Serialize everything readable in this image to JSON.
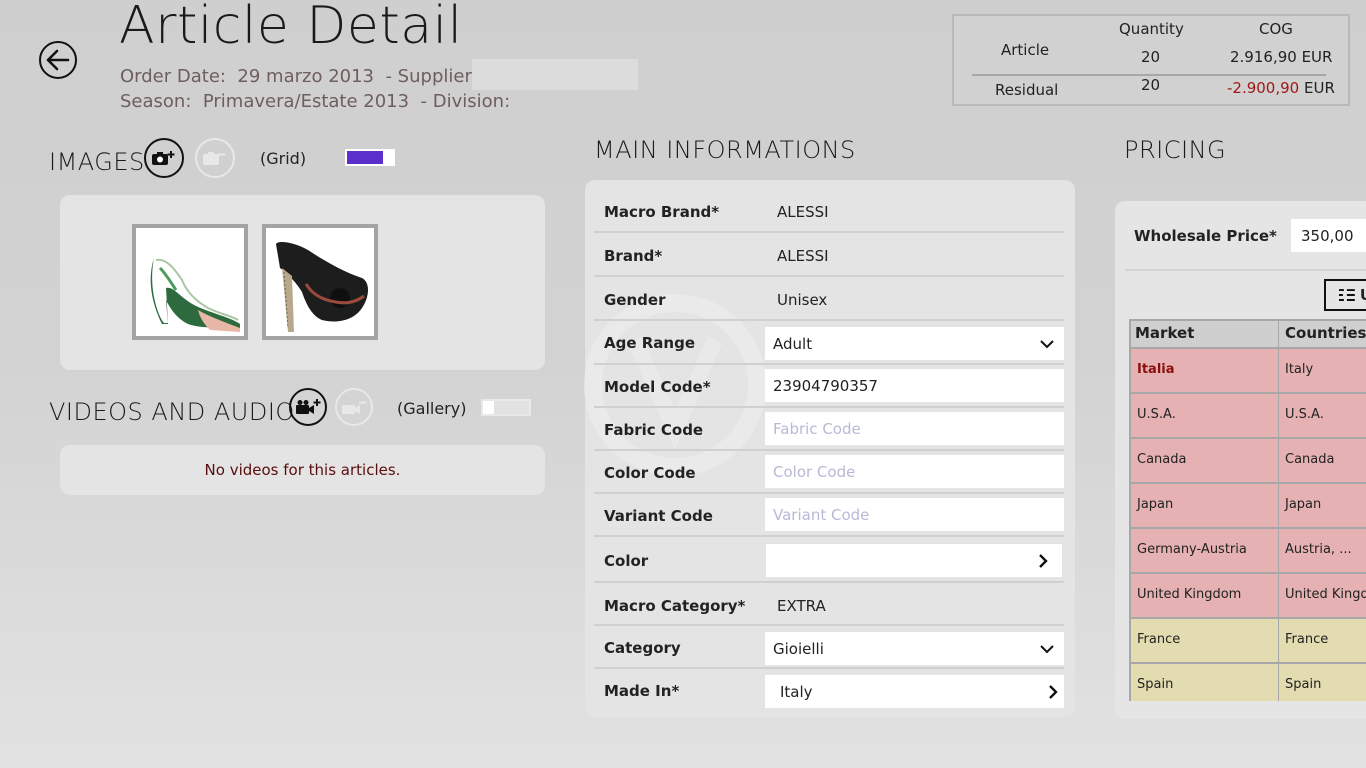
{
  "header": {
    "title": "Article Detail",
    "order_date_label": "Order Date:",
    "order_date": "29 marzo 2013",
    "supplier_label": "- Supplier:",
    "season_label": "Season:",
    "season": "Primavera/Estate 2013",
    "division_label": "- Division:"
  },
  "summary": {
    "col_quantity": "Quantity",
    "col_cog": "COG",
    "article_label": "Article",
    "article_quantity": "20",
    "article_cog": "2.916,90",
    "article_currency": "EUR",
    "residual_label": "Residual",
    "residual_quantity": "20",
    "residual_cog": "-2.900,90",
    "residual_currency": "EUR"
  },
  "images": {
    "title": "IMAGES",
    "view_label": "(Grid)",
    "toggle_on": true,
    "accent": "#5b2fc9"
  },
  "videos": {
    "title": "VIDEOS AND AUDIO",
    "view_label": "(Gallery)",
    "empty_message": "No videos for this articles."
  },
  "main": {
    "title": "MAIN INFORMATIONS",
    "fields": [
      {
        "label": "Macro Brand*",
        "value": "ALESSI"
      },
      {
        "label": "Brand*",
        "value": "ALESSI"
      },
      {
        "label": "Gender",
        "value": "Unisex"
      },
      {
        "label": "Age Range",
        "value": "Adult"
      },
      {
        "label": "Model Code*",
        "value": "23904790357"
      },
      {
        "label": "Fabric Code",
        "placeholder": "Fabric Code"
      },
      {
        "label": "Color Code",
        "placeholder": "Color Code"
      },
      {
        "label": "Variant Code",
        "placeholder": "Variant Code"
      },
      {
        "label": "Color",
        "value": ""
      },
      {
        "label": "Macro Category*",
        "value": "EXTRA"
      },
      {
        "label": "Category",
        "value": "Gioielli"
      },
      {
        "label": "Made In*",
        "value": "Italy"
      }
    ]
  },
  "pricing": {
    "title": "PRICING",
    "wholesale_label": "Wholesale Price*",
    "wholesale_value": "350,00",
    "button_label": "U",
    "columns": [
      "Market",
      "Countries"
    ],
    "rows": [
      {
        "market": "Italia",
        "countries": "Italy",
        "status": "pink"
      },
      {
        "market": "U.S.A.",
        "countries": "U.S.A.",
        "status": "pink"
      },
      {
        "market": "Canada",
        "countries": "Canada",
        "status": "pink"
      },
      {
        "market": "Japan",
        "countries": "Japan",
        "status": "pink"
      },
      {
        "market": "Germany-Austria",
        "countries": "Austria, ...",
        "status": "pink"
      },
      {
        "market": "United Kingdom",
        "countries": "United Kingd",
        "status": "pink"
      },
      {
        "market": "France",
        "countries": "France",
        "status": "yellow"
      },
      {
        "market": "Spain",
        "countries": "Spain",
        "status": "yellow"
      }
    ]
  }
}
